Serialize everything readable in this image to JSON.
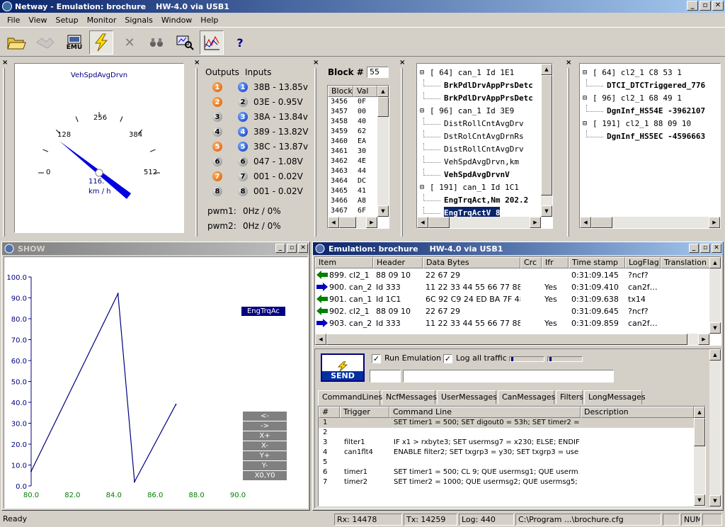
{
  "window": {
    "title": "Netway - Emulation: brochure",
    "hw": "HW-4.0 via USB1",
    "minimize": "_",
    "maximize": "▫",
    "close": "✕"
  },
  "menu": [
    "File",
    "View",
    "Setup",
    "Monitor",
    "Signals",
    "Window",
    "Help"
  ],
  "toolbar": {
    "emu_label": "EMU",
    "help": "?"
  },
  "gauge": {
    "title": "VehSpdAvgDrvn",
    "ticks": [
      "0",
      "128",
      "256",
      "384",
      "512"
    ],
    "value": 116,
    "readout": "116.",
    "unit": "km / h"
  },
  "io": {
    "outputs_label": "Outputs",
    "inputs_label": "Inputs",
    "rows": [
      {
        "out": "1",
        "out_color": "o",
        "in": "1",
        "in_color": "b",
        "text": "38B - 13.85v"
      },
      {
        "out": "2",
        "out_color": "o",
        "in": "2",
        "in_color": "g",
        "text": "03E - 0.95V"
      },
      {
        "out": "3",
        "out_color": "g",
        "in": "3",
        "in_color": "b",
        "text": "38A - 13.84v"
      },
      {
        "out": "4",
        "out_color": "g",
        "in": "4",
        "in_color": "b",
        "text": "389 - 13.82V"
      },
      {
        "out": "5",
        "out_color": "o",
        "in": "5",
        "in_color": "b",
        "text": "38C - 13.87v"
      },
      {
        "out": "6",
        "out_color": "g",
        "in": "6",
        "in_color": "g",
        "text": "047 - 1.08V"
      },
      {
        "out": "7",
        "out_color": "o",
        "in": "7",
        "in_color": "g",
        "text": "001 - 0.02V"
      },
      {
        "out": "8",
        "out_color": "g",
        "in": "8",
        "in_color": "g",
        "text": "001 - 0.02V"
      }
    ],
    "pwm1_label": "pwm1:",
    "pwm1_value": "0Hz / 0%",
    "pwm2_label": "pwm2:",
    "pwm2_value": "0Hz / 0%"
  },
  "block": {
    "label": "Block #",
    "number": "55",
    "col_block": "Block",
    "col_val": "Val",
    "rows": [
      [
        "3456",
        "0F"
      ],
      [
        "3457",
        "00"
      ],
      [
        "3458",
        "40"
      ],
      [
        "3459",
        "62"
      ],
      [
        "3460",
        "EA"
      ],
      [
        "3461",
        "30"
      ],
      [
        "3462",
        "4E"
      ],
      [
        "3463",
        "44"
      ],
      [
        "3464",
        "DC"
      ],
      [
        "3465",
        "41"
      ],
      [
        "3466",
        "A8"
      ],
      [
        "3467",
        "6F"
      ]
    ]
  },
  "tree1": [
    {
      "text": "[  64] can_1  Id 1E1",
      "bold": false,
      "level": 0,
      "expander": "⊟"
    },
    {
      "text": "BrkPdlDrvAppPrsDetc",
      "bold": true,
      "level": 1
    },
    {
      "text": "BrkPdlDrvAppPrsDetc",
      "bold": true,
      "level": 1
    },
    {
      "text": "[  96] can_1  Id 3E9",
      "bold": false,
      "level": 0,
      "expander": "⊟"
    },
    {
      "text": "DistRollCntAvgDrv",
      "bold": false,
      "level": 1
    },
    {
      "text": "DstRolCntAvgDrnRs",
      "bold": false,
      "level": 1
    },
    {
      "text": "DistRollCntAvgDrv",
      "bold": false,
      "level": 1
    },
    {
      "text": "VehSpdAvgDrvn,km",
      "bold": false,
      "level": 1
    },
    {
      "text": "VehSpdAvgDrvnV",
      "bold": true,
      "level": 1
    },
    {
      "text": "[ 191] can_1  Id 1C1",
      "bold": false,
      "level": 0,
      "expander": "⊟"
    },
    {
      "text": "EngTrqAct,Nm  202.2",
      "bold": true,
      "level": 1
    },
    {
      "text": "EngTrqActV  8",
      "bold": true,
      "level": 1,
      "selected": true
    }
  ],
  "tree2": [
    {
      "text": "[  64] cl2_1  C8 53 1",
      "bold": false,
      "level": 0,
      "expander": "⊟"
    },
    {
      "text": "DTCI_DTCTriggered_776",
      "bold": true,
      "level": 1
    },
    {
      "text": "[  96] cl2_1  68 49 1",
      "bold": false,
      "level": 0,
      "expander": "⊟"
    },
    {
      "text": "DgnInf_HS54E  -3962107",
      "bold": true,
      "level": 1
    },
    {
      "text": "[ 191] cl2_1  88 09 10",
      "bold": false,
      "level": 0,
      "expander": "⊟"
    },
    {
      "text": "DgnInf_HS5EC  -4596663",
      "bold": true,
      "level": 1
    }
  ],
  "show": {
    "title": "SHOW",
    "series_label": "EngTrqAc",
    "buttons": [
      "<-",
      "->",
      "X+",
      "X-",
      "Y+",
      "Y-",
      "X0,Y0"
    ]
  },
  "chart_data": {
    "type": "line",
    "title": "",
    "xlabel": "",
    "ylabel": "",
    "xlim": [
      80.0,
      90.0
    ],
    "ylim": [
      0.0,
      100.0
    ],
    "x_ticks": [
      "80.0",
      "82.0",
      "84.0",
      "86.0",
      "88.0",
      "90.0"
    ],
    "y_ticks": [
      "0.0",
      "10.0",
      "20.0",
      "30.0",
      "40.0",
      "50.0",
      "60.0",
      "70.0",
      "80.0",
      "90.0",
      "100.0"
    ],
    "series": [
      {
        "name": "EngTrqAc",
        "color": "#00007f",
        "x": [
          80.0,
          84.2,
          85.0,
          87.0
        ],
        "y": [
          7.0,
          92.0,
          2.0,
          39.0
        ]
      }
    ]
  },
  "emulation": {
    "title": "Emulation: brochure",
    "hw": "HW-4.0 via USB1",
    "columns": [
      "Item",
      "Header",
      "Data Bytes",
      "Crc",
      "Ifr",
      "Time stamp",
      "LogFlag",
      "Translation"
    ],
    "rows": [
      {
        "dir": "in",
        "item": "899. cl2_1",
        "header": "88 09 10",
        "data": "22 67 29",
        "crc": "",
        "ifr": "",
        "time": "0:31:09.145",
        "log": "?ncf?",
        "trans": ""
      },
      {
        "dir": "out",
        "item": "900. can_2",
        "header": "Id 333",
        "data": "11 22 33 44 55 66 77 88",
        "crc": "",
        "ifr": "Yes",
        "time": "0:31:09.410",
        "log": "can2f…",
        "trans": ""
      },
      {
        "dir": "in",
        "item": "901. can_1",
        "header": "Id 1C1",
        "data": "6C 92 C9 24 ED BA 7F 48",
        "crc": "",
        "ifr": "Yes",
        "time": "0:31:09.638",
        "log": "tx14",
        "trans": ""
      },
      {
        "dir": "in",
        "item": "902. cl2_1",
        "header": "88 09 10",
        "data": "22 67 29",
        "crc": "",
        "ifr": "",
        "time": "0:31:09.645",
        "log": "?ncf?",
        "trans": ""
      },
      {
        "dir": "out",
        "item": "903. can_2",
        "header": "Id 333",
        "data": "11 22 33 44 55 66 77 88",
        "crc": "",
        "ifr": "Yes",
        "time": "0:31:09.859",
        "log": "can2f…",
        "trans": ""
      }
    ],
    "send_label": "SEND",
    "run_emulation_label": "Run Emulation",
    "run_emulation_checked": true,
    "log_all_label": "Log all traffic",
    "log_all_checked": true,
    "tabs": [
      "CommandLines",
      "NcfMessages",
      "UserMessages",
      "CanMessages",
      "Filters",
      "LongMessages"
    ],
    "cmd_columns": [
      "#",
      "Trigger",
      "Command Line",
      "Description"
    ],
    "cmd_rows": [
      {
        "n": "1",
        "trigger": "",
        "cmd": "SET timer1 = 500; SET digout0 = 53h; SET timer2 = ...",
        "desc": ""
      },
      {
        "n": "2",
        "trigger": "",
        "cmd": "",
        "desc": ""
      },
      {
        "n": "3",
        "trigger": "filter1",
        "cmd": "IF x1 > rxbyte3; SET usermsg7 = x230; ELSE; ENDIF;",
        "desc": ""
      },
      {
        "n": "4",
        "trigger": "can1flt4",
        "cmd": "ENABLE filter2; SET txgrp3 = y30; SET txgrp3 = user...",
        "desc": ""
      },
      {
        "n": "5",
        "trigger": "",
        "cmd": "",
        "desc": ""
      },
      {
        "n": "6",
        "trigger": "timer1",
        "cmd": "SET timer1 = 500; CL 9; QUE usermsg1; QUE userm...",
        "desc": ""
      },
      {
        "n": "7",
        "trigger": "timer2",
        "cmd": "SET timer2 = 1000; QUE usermsg2; QUE usermsg5;",
        "desc": ""
      }
    ]
  },
  "status": {
    "ready": "Ready",
    "rx": "Rx: 14478",
    "tx": "Tx: 14259",
    "log": "Log: 440",
    "file": "C:\\Program ...\\brochure.cfg",
    "num": "NUM"
  }
}
